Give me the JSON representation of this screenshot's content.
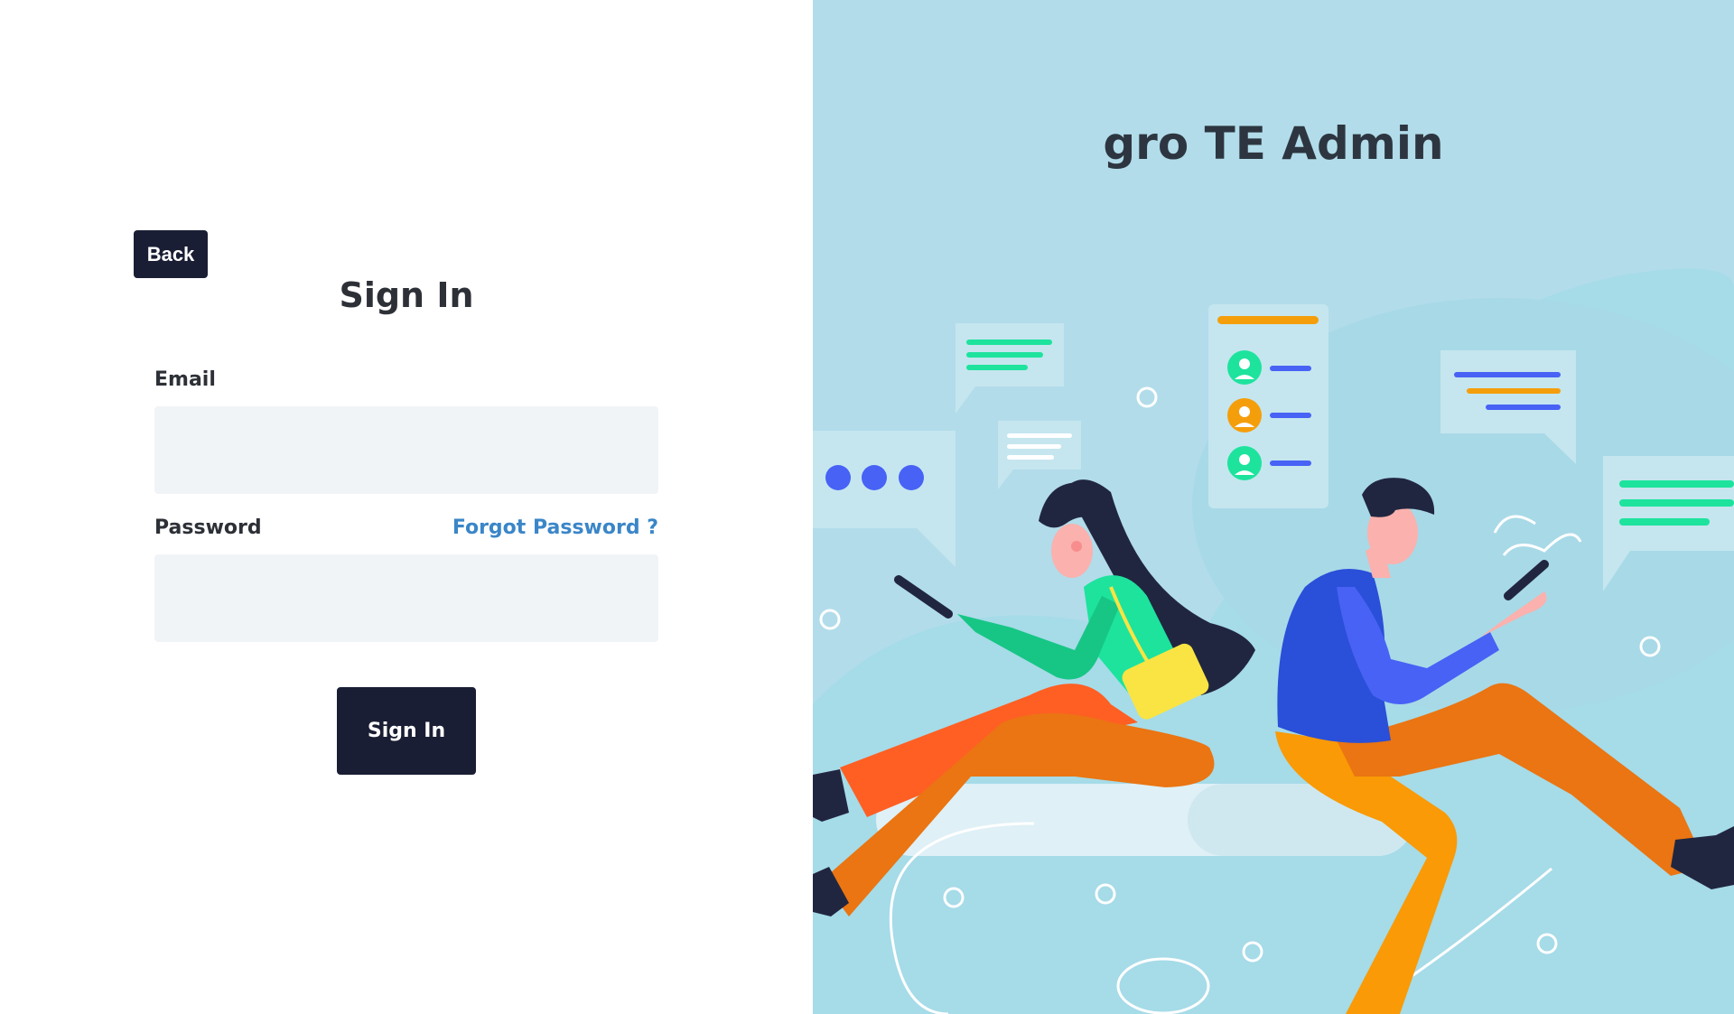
{
  "login": {
    "back_label": "Back",
    "title": "Sign In",
    "email_label": "Email",
    "email_value": "",
    "password_label": "Password",
    "password_value": "",
    "forgot_label": "Forgot Password ?",
    "submit_label": "Sign In"
  },
  "brand": {
    "title": "gro TE Admin"
  },
  "colors": {
    "dark_button": "#1a1e34",
    "input_bg": "#f1f4f7",
    "link": "#3a86c8",
    "illustration_bg": "#b2dcea",
    "accent_green": "#1de39d",
    "accent_orange": "#f59e0b",
    "accent_blue": "#4762f5"
  },
  "icons": {
    "illustration": "people-chatting-illustration"
  }
}
